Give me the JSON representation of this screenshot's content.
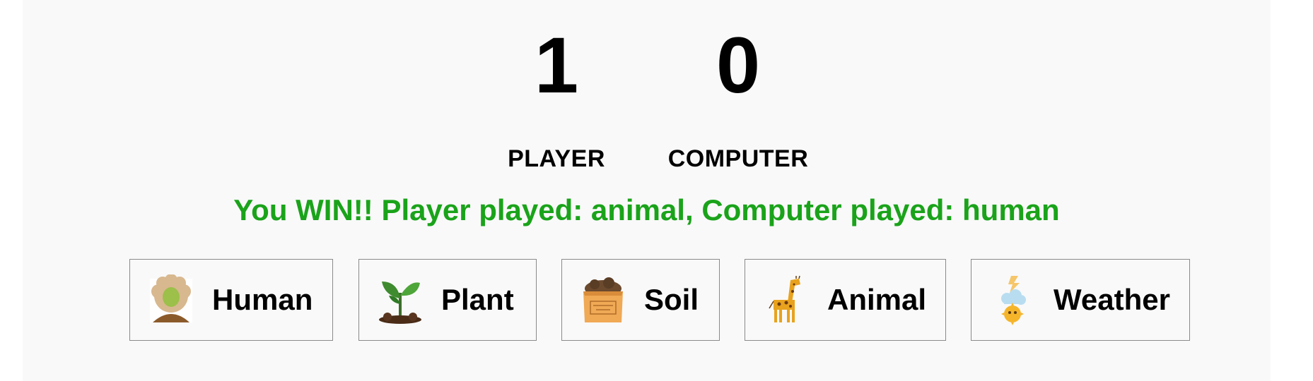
{
  "scoreboard": {
    "player": {
      "score": "1",
      "label": "PLAYER"
    },
    "computer": {
      "score": "0",
      "label": "COMPUTER"
    }
  },
  "result": {
    "text": "You WIN!! Player played: animal, Computer played: human",
    "color": "#1aa31a"
  },
  "choices": [
    {
      "label": "Human",
      "icon": "human-icon"
    },
    {
      "label": "Plant",
      "icon": "plant-icon"
    },
    {
      "label": "Soil",
      "icon": "soil-bag-icon"
    },
    {
      "label": "Animal",
      "icon": "giraffe-icon"
    },
    {
      "label": "Weather",
      "icon": "weather-icon"
    }
  ]
}
